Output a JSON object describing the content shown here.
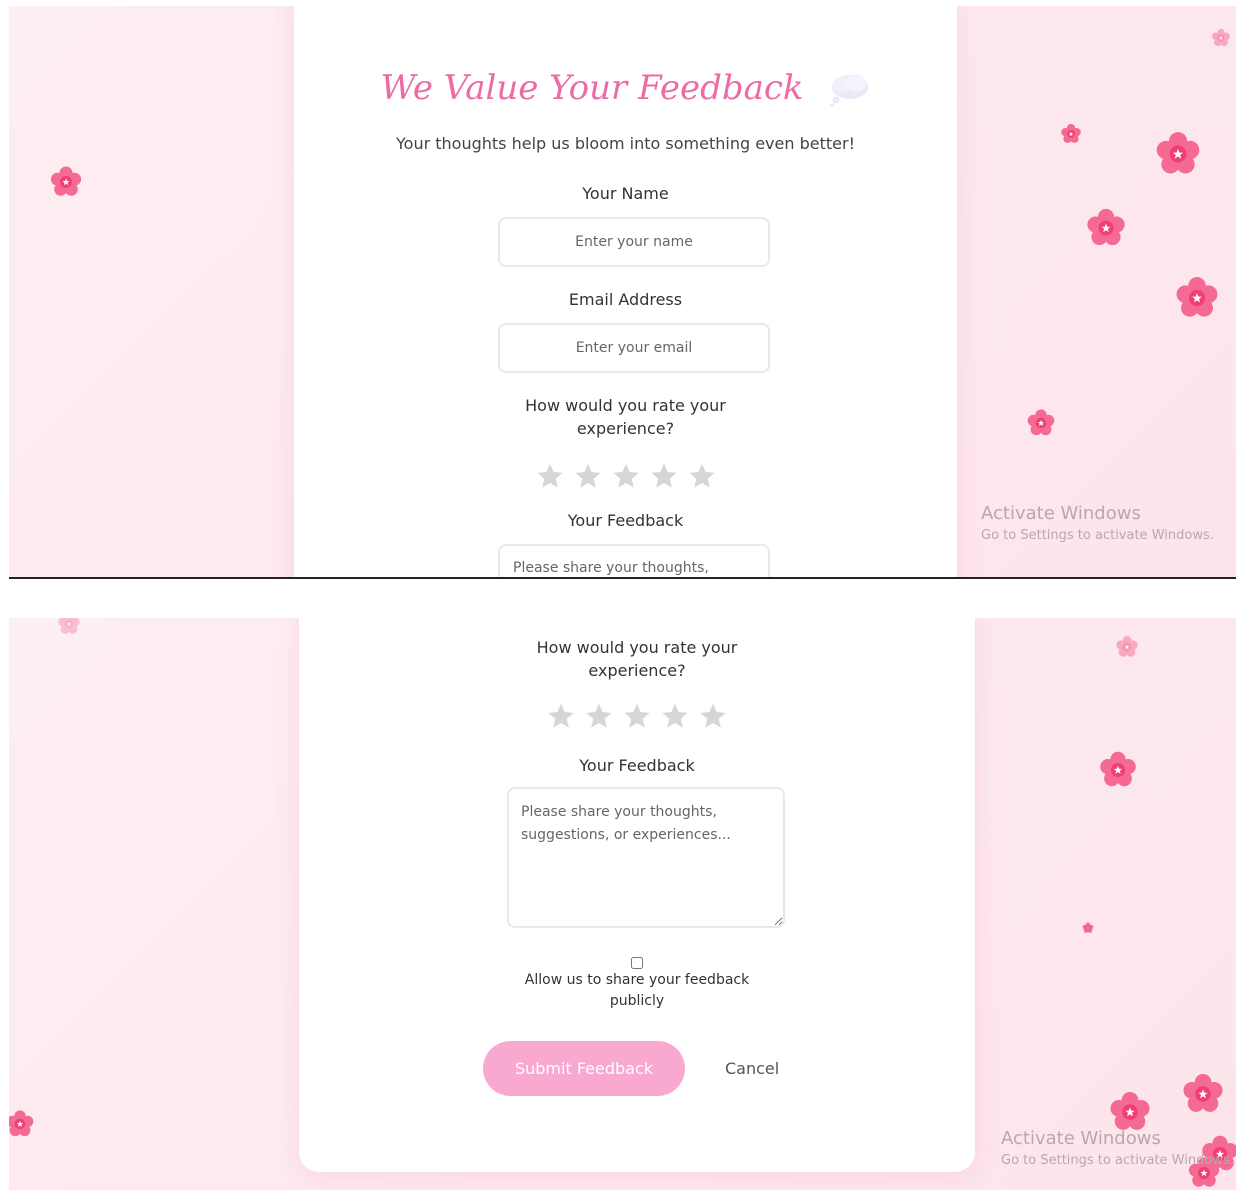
{
  "form": {
    "title": "We Value Your Feedback",
    "subtitle": "Your thoughts help us bloom into something even better!",
    "name_label": "Your Name",
    "name_placeholder": "Enter your name",
    "email_label": "Email Address",
    "email_placeholder": "Enter your email",
    "rating_label_line1": "How would you rate your",
    "rating_label_line2": "experience?",
    "rating_value": 0,
    "rating_max": 5,
    "feedback_label": "Your Feedback",
    "feedback_placeholder": "Please share your thoughts, suggestions, or experiences...",
    "feedback_placeholder_line1": "Please share your thoughts,",
    "public_checkbox_checked": false,
    "public_checkbox_line1": "Allow us to share your feedback",
    "public_checkbox_line2": "publicly",
    "submit_label": "Submit Feedback",
    "cancel_label": "Cancel"
  },
  "watermark": {
    "title": "Activate Windows",
    "subtitle": "Go to Settings to activate Windows."
  },
  "colors": {
    "accent": "#ee6aa7",
    "submit_bg": "#f9a8d0",
    "background": "#fde8ef",
    "star_empty": "#d6d6d6",
    "flower": "#f25c8a"
  }
}
